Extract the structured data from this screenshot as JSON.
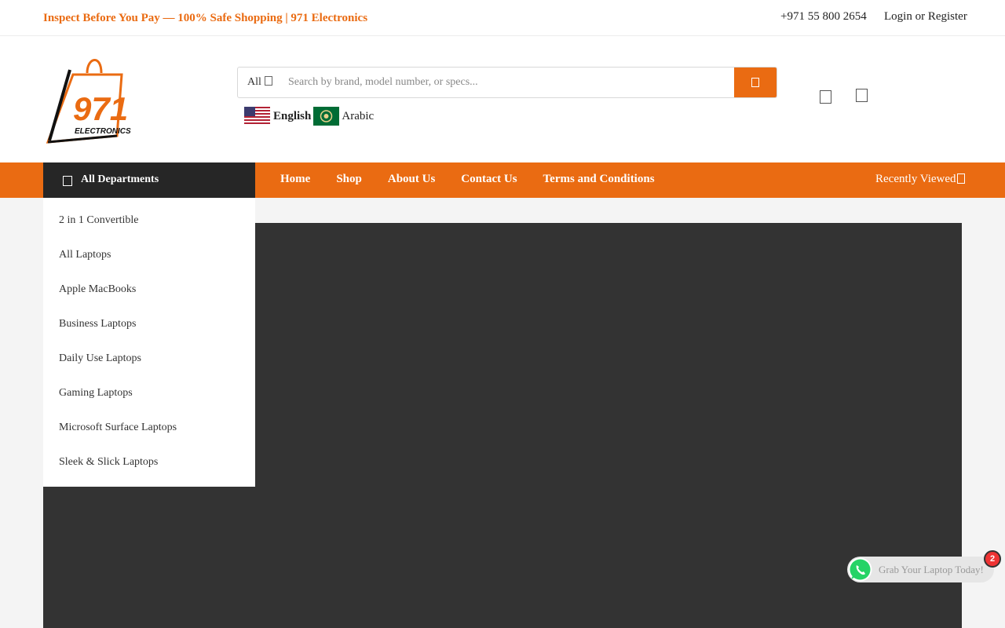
{
  "topbar": {
    "promo": "Inspect Before You Pay — 100% Safe Shopping | 971 Electronics",
    "phone": "+971 55 800 2654",
    "login": "Login or Register"
  },
  "logo": {
    "number": "971",
    "word": "ELECTRONICS"
  },
  "search": {
    "category": "All",
    "placeholder": "Search by brand, model number, or specs...",
    "value": ""
  },
  "languages": {
    "english": "English",
    "arabic": "Arabic"
  },
  "nav": {
    "departments_label": "All Departments",
    "links": [
      "Home",
      "Shop",
      "About Us",
      "Contact Us",
      "Terms and Conditions"
    ],
    "recently_viewed": "Recently Viewed"
  },
  "departments": [
    "2 in 1 Convertible",
    "All Laptops",
    "Apple MacBooks",
    "Business Laptops",
    "Daily Use Laptops",
    "Gaming Laptops",
    "Microsoft Surface Laptops",
    "Sleek & Slick Laptops"
  ],
  "whatsapp": {
    "text": "Grab Your Laptop Today!",
    "badge": "2"
  },
  "colors": {
    "accent": "#ea6b12",
    "dark": "#262626",
    "hero": "#333333"
  },
  "icons": {
    "search_button": "search-icon",
    "header_left": "wishlist-icon",
    "header_right": "cart-icon",
    "departments": "menu-icon",
    "recently_viewed": "chevron-down-icon"
  }
}
